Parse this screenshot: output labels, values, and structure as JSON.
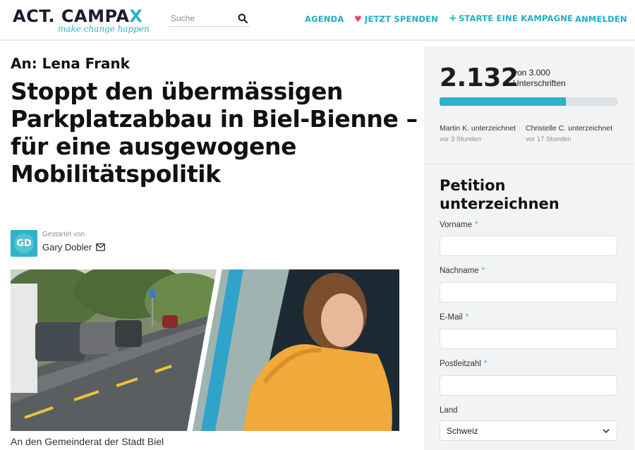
{
  "header": {
    "logo_text": "ACT. CAMPA",
    "logo_x": "X",
    "logo_tagline": "make change happen",
    "search_placeholder": "Suche",
    "nav": {
      "agenda": "AGENDA",
      "donate": "JETZT SPENDEN",
      "start_campaign": "STARTE EINE KAMPAGNE",
      "login": "ANMELDEN"
    }
  },
  "petition": {
    "addressee": "An: Lena Frank",
    "title": "Stoppt den übermässigen Parkplatzabbau in Biel-Bienne – für eine ausgewogene Mobilitätspolitik",
    "started_by_label": "Gestartet von",
    "starter_initials": "GD",
    "starter_name": "Gary Dobler",
    "caption": "An den Gemeinderat der Stadt Biel"
  },
  "signatures": {
    "count": "2.132",
    "goal_line1": "von 3.000",
    "goal_line2": "Unterschriften",
    "progress_fraction": 0.711,
    "recent": [
      {
        "name": "Martin K. unterzeichnet",
        "time": "vor 3 Stunden"
      },
      {
        "name": "Christelle C. unterzeichnet",
        "time": "vor 17 Stunden"
      }
    ]
  },
  "form": {
    "heading_line1": "Petition",
    "heading_line2": "unterzeichnen",
    "fields": {
      "vorname": "Vorname",
      "nachname": "Nachname",
      "email": "E-Mail",
      "plz": "Postleitzahl",
      "land": "Land"
    },
    "required_mark": "*",
    "country_value": "Schweiz"
  },
  "colors": {
    "accent": "#2bb3c8",
    "heart": "#e2467a",
    "sidebar_bg": "#f2f3f4"
  }
}
